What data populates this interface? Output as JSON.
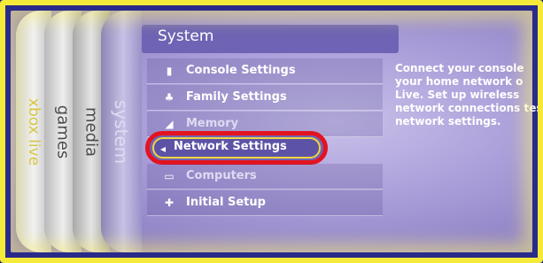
{
  "blades": [
    {
      "label": "xbox live"
    },
    {
      "label": "games"
    },
    {
      "label": "media"
    },
    {
      "label": "system"
    }
  ],
  "panel": {
    "title": "System",
    "items": [
      {
        "label": "Console Settings",
        "icon": "console-icon"
      },
      {
        "label": "Family Settings",
        "icon": "family-icon"
      },
      {
        "label": "Memory",
        "icon": "memory-icon"
      },
      {
        "label": "Network Settings",
        "icon": "network-icon",
        "selected": true
      },
      {
        "label": "Computers",
        "icon": "computers-icon"
      },
      {
        "label": "Initial Setup",
        "icon": "setup-icon"
      }
    ],
    "description": "Connect your console your home network o Live. Set up wireless network connections test network settings."
  },
  "colors": {
    "frame_border": "#f3ea3a",
    "highlight_ring": "#e3141f",
    "title_bar": "#6e63b4"
  }
}
